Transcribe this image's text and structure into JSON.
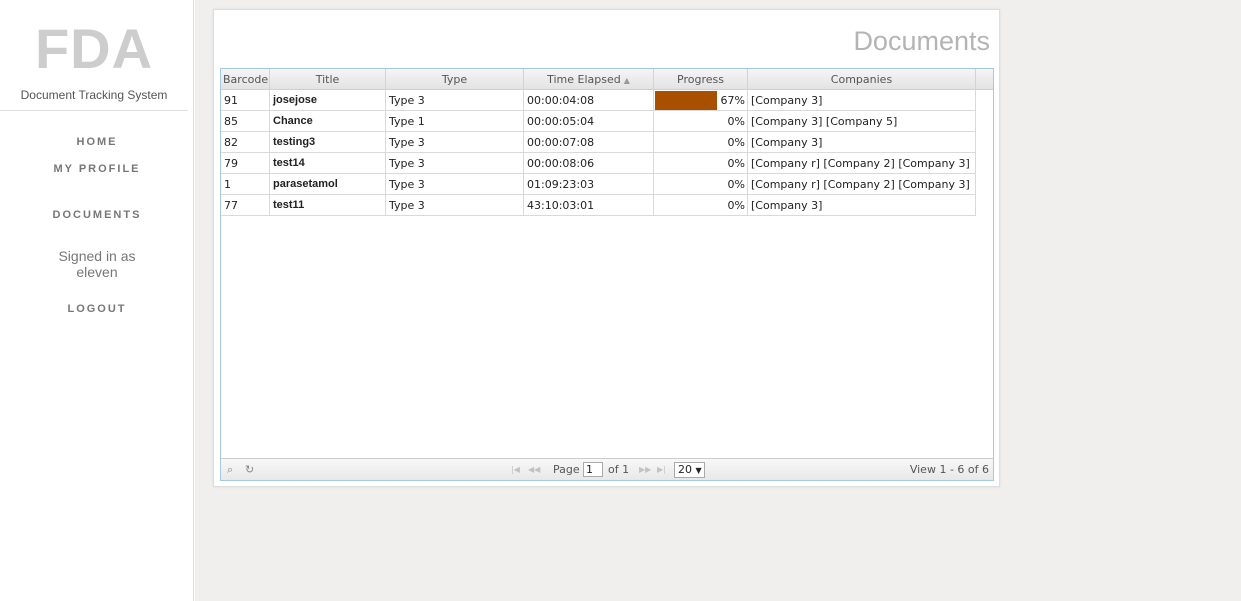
{
  "sidebar": {
    "logo": "FDA",
    "subtitle": "Document Tracking System",
    "nav": {
      "home": "HOME",
      "profile": "MY PROFILE",
      "documents": "DOCUMENTS",
      "logout": "LOGOUT"
    },
    "signed_in_line1": "Signed in as",
    "signed_in_user": "eleven"
  },
  "main": {
    "title": "Documents",
    "grid": {
      "columns": [
        "Barcode",
        "Title",
        "Type",
        "Time Elapsed",
        "Progress",
        "Companies"
      ],
      "sort_icon": "sort-icon",
      "rows": [
        {
          "barcode": "91",
          "title": "josejose",
          "type": "Type 3",
          "elapsed": "00:00:04:08",
          "progress": "67%",
          "progress_value": 0.67,
          "companies": "[Company 3]"
        },
        {
          "barcode": "85",
          "title": "Chance",
          "type": "Type 1",
          "elapsed": "00:00:05:04",
          "progress": "0%",
          "progress_value": 0,
          "companies": "[Company 3] [Company 5]"
        },
        {
          "barcode": "82",
          "title": "testing3",
          "type": "Type 3",
          "elapsed": "00:00:07:08",
          "progress": "0%",
          "progress_value": 0,
          "companies": "[Company 3]"
        },
        {
          "barcode": "79",
          "title": "test14",
          "type": "Type 3",
          "elapsed": "00:00:08:06",
          "progress": "0%",
          "progress_value": 0,
          "companies": "[Company r] [Company 2] [Company 3]"
        },
        {
          "barcode": "1",
          "title": "parasetamol",
          "type": "Type 3",
          "elapsed": "01:09:23:03",
          "progress": "0%",
          "progress_value": 0,
          "companies": "[Company r] [Company 2] [Company 3]"
        },
        {
          "barcode": "77",
          "title": "test11",
          "type": "Type 3",
          "elapsed": "43:10:03:01",
          "progress": "0%",
          "progress_value": 0,
          "companies": "[Company 3]"
        }
      ],
      "progress_color": "#a84f00"
    },
    "pager": {
      "page_label": "Page",
      "page_value": "1",
      "of_label": "of 1",
      "rows_per_page": "20",
      "view_label": "View 1 - 6 of 6"
    }
  }
}
